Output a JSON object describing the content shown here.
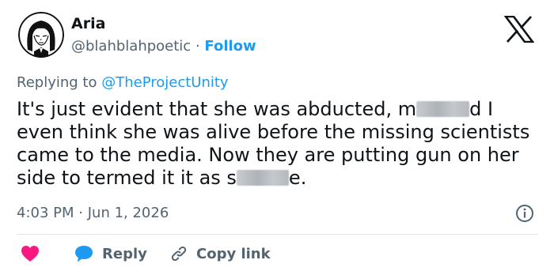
{
  "user": {
    "name": "Aria",
    "handle": "@blahblahpoetic",
    "separator": "·",
    "follow_label": "Follow"
  },
  "reply_context": {
    "prefix": "Replying to",
    "mention": "@TheProjectUnity"
  },
  "tweet": {
    "segments": [
      "It's just evident that she was abducted, m",
      "d I even think she was alive before the missing scientists came to the media. Now they are putting gun on her side to termed it it as s",
      "e."
    ]
  },
  "meta": {
    "time": "4:03 PM",
    "separator": "·",
    "date": "Jun 1, 2026"
  },
  "actions": {
    "reply_label": "Reply",
    "copy_link_label": "Copy link"
  },
  "colors": {
    "accent": "#1d9bf0",
    "heart": "#f91880",
    "secondary_text": "#536471",
    "primary_text": "#0f1419"
  },
  "icons": [
    "x-logo-icon",
    "info-icon",
    "heart-icon",
    "reply-bubble-icon",
    "link-icon"
  ]
}
